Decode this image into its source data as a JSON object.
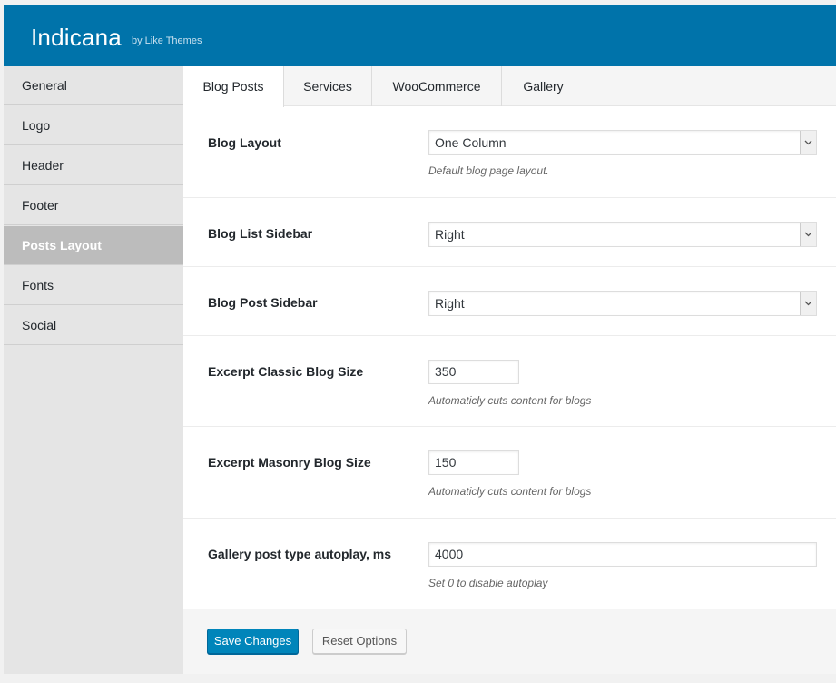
{
  "header": {
    "title": "Indicana",
    "subtitle": "by Like Themes",
    "bg_color": "#0073aa"
  },
  "sidebar": {
    "items": [
      {
        "label": "General"
      },
      {
        "label": "Logo"
      },
      {
        "label": "Header"
      },
      {
        "label": "Footer"
      },
      {
        "label": "Posts Layout",
        "active": true
      },
      {
        "label": "Fonts"
      },
      {
        "label": "Social"
      }
    ]
  },
  "tabs": [
    {
      "label": "Blog Posts",
      "active": true
    },
    {
      "label": "Services"
    },
    {
      "label": "WooCommerce"
    },
    {
      "label": "Gallery"
    }
  ],
  "fields": {
    "blog_layout": {
      "label": "Blog Layout",
      "value": "One Column",
      "description": "Default blog page layout."
    },
    "blog_list_sidebar": {
      "label": "Blog List Sidebar",
      "value": "Right"
    },
    "blog_post_sidebar": {
      "label": "Blog Post Sidebar",
      "value": "Right"
    },
    "excerpt_classic": {
      "label": "Excerpt Classic Blog Size",
      "value": "350",
      "description": "Automaticly cuts content for blogs"
    },
    "excerpt_masonry": {
      "label": "Excerpt Masonry Blog Size",
      "value": "150",
      "description": "Automaticly cuts content for blogs"
    },
    "gallery_autoplay": {
      "label": "Gallery post type autoplay, ms",
      "value": "4000",
      "description": "Set 0 to disable autoplay"
    }
  },
  "buttons": {
    "save_label": "Save Changes",
    "reset_label": "Reset Options"
  },
  "icons": {
    "dropdown": "chevron-down-icon"
  }
}
